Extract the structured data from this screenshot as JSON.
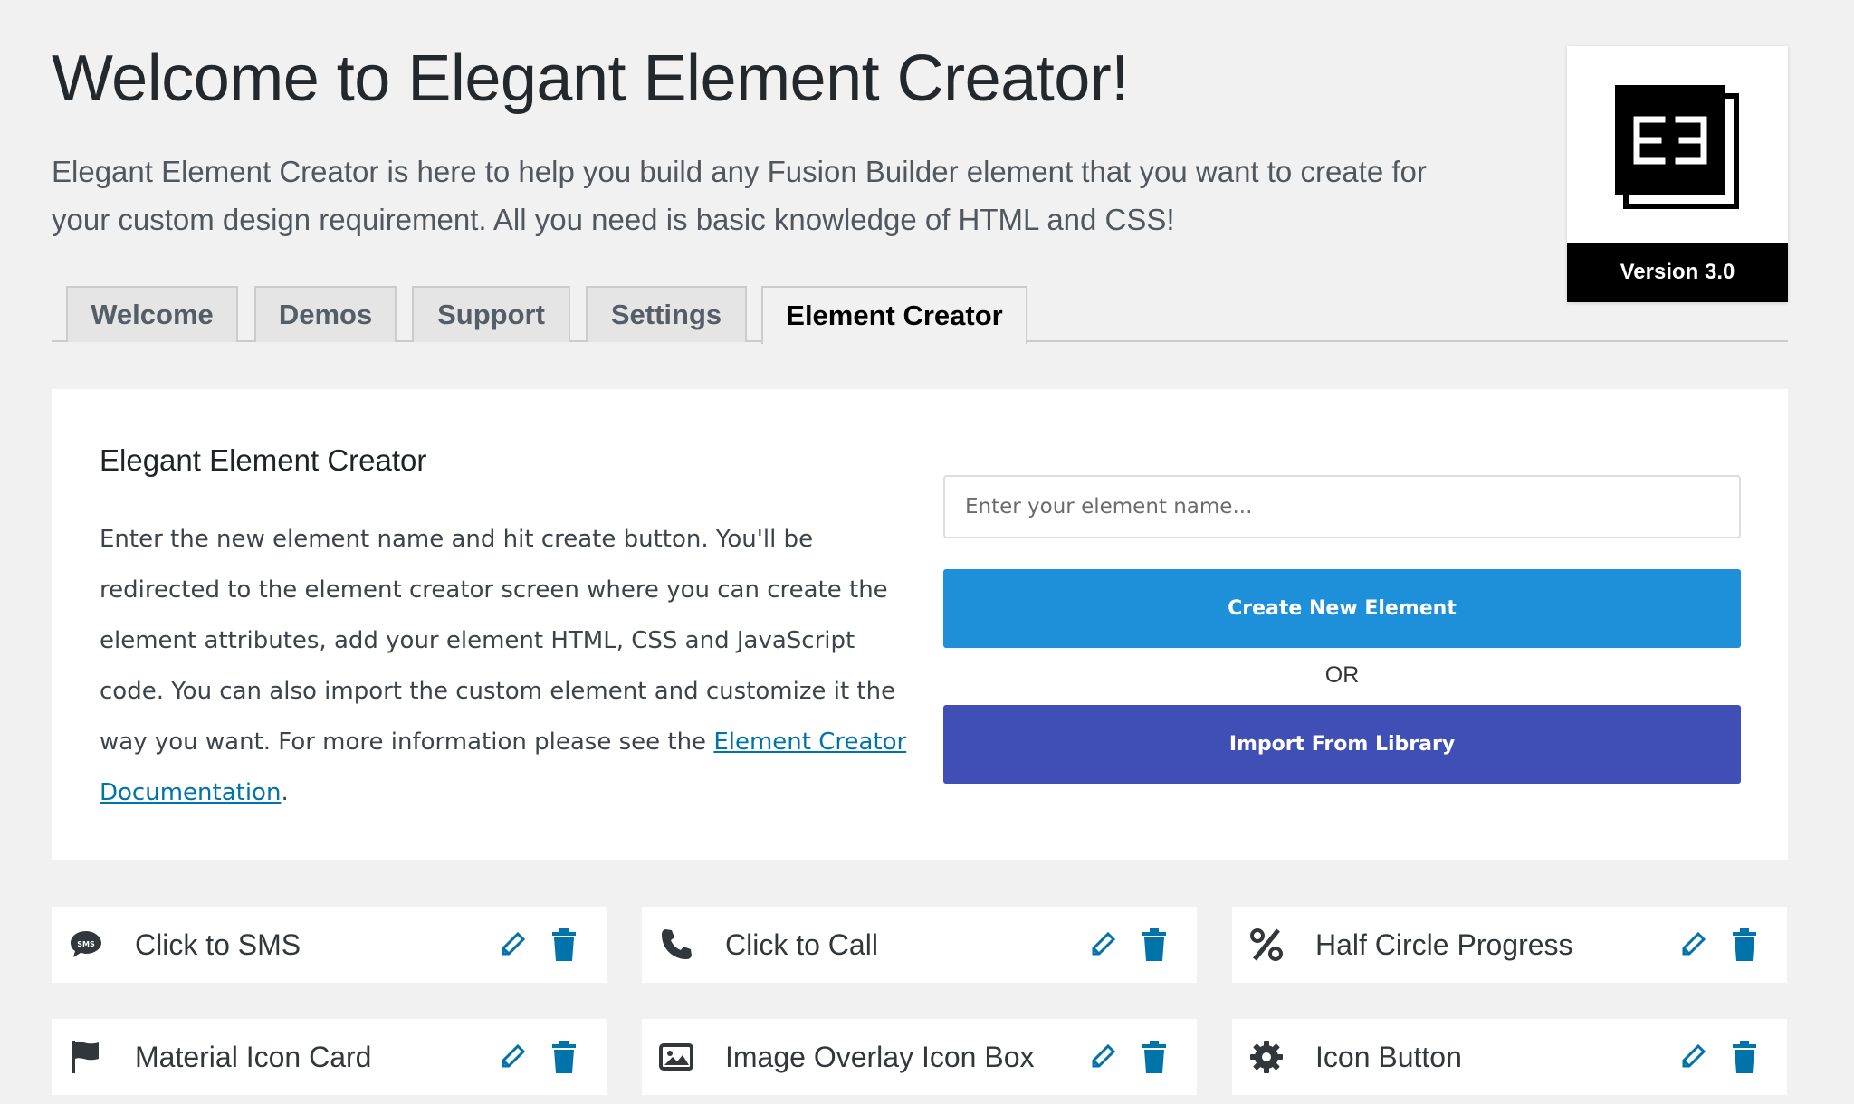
{
  "header": {
    "title": "Welcome to Elegant Element Creator!",
    "intro": "Elegant Element Creator is here to help you build any Fusion Builder element that you want to create for your custom design requirement. All you need is basic knowledge of HTML and CSS!"
  },
  "badge": {
    "logo_icon": "elegant-elements-logo",
    "version": "Version 3.0"
  },
  "tabs": [
    {
      "label": "Welcome",
      "active": false
    },
    {
      "label": "Demos",
      "active": false
    },
    {
      "label": "Support",
      "active": false
    },
    {
      "label": "Settings",
      "active": false
    },
    {
      "label": "Element Creator",
      "active": true
    }
  ],
  "creator": {
    "title": "Elegant Element Creator",
    "description": "Enter the new element name and hit create button. You'll be redirected to the element creator screen where you can create the element attributes, add your element HTML, CSS and JavaScript code. You can also import the custom element and customize it the way you want. For more information please see the ",
    "link_text": "Element Creator Documentation",
    "description_end": ".",
    "input_placeholder": "Enter your element name...",
    "input_value": "",
    "create_label": "Create New Element",
    "or_label": "OR",
    "import_label": "Import From Library",
    "create_color": "#1e90d9",
    "import_color": "#3f4fb5"
  },
  "elements": [
    {
      "name": "Click to SMS",
      "icon": "sms-icon"
    },
    {
      "name": "Click to Call",
      "icon": "phone-icon"
    },
    {
      "name": "Half Circle Progress",
      "icon": "percent-icon"
    },
    {
      "name": "Material Icon Card",
      "icon": "flag-icon"
    },
    {
      "name": "Image Overlay Icon Box",
      "icon": "image-icon"
    },
    {
      "name": "Icon Button",
      "icon": "gear-icon"
    }
  ],
  "colors": {
    "action_icon": "#0073aa"
  }
}
